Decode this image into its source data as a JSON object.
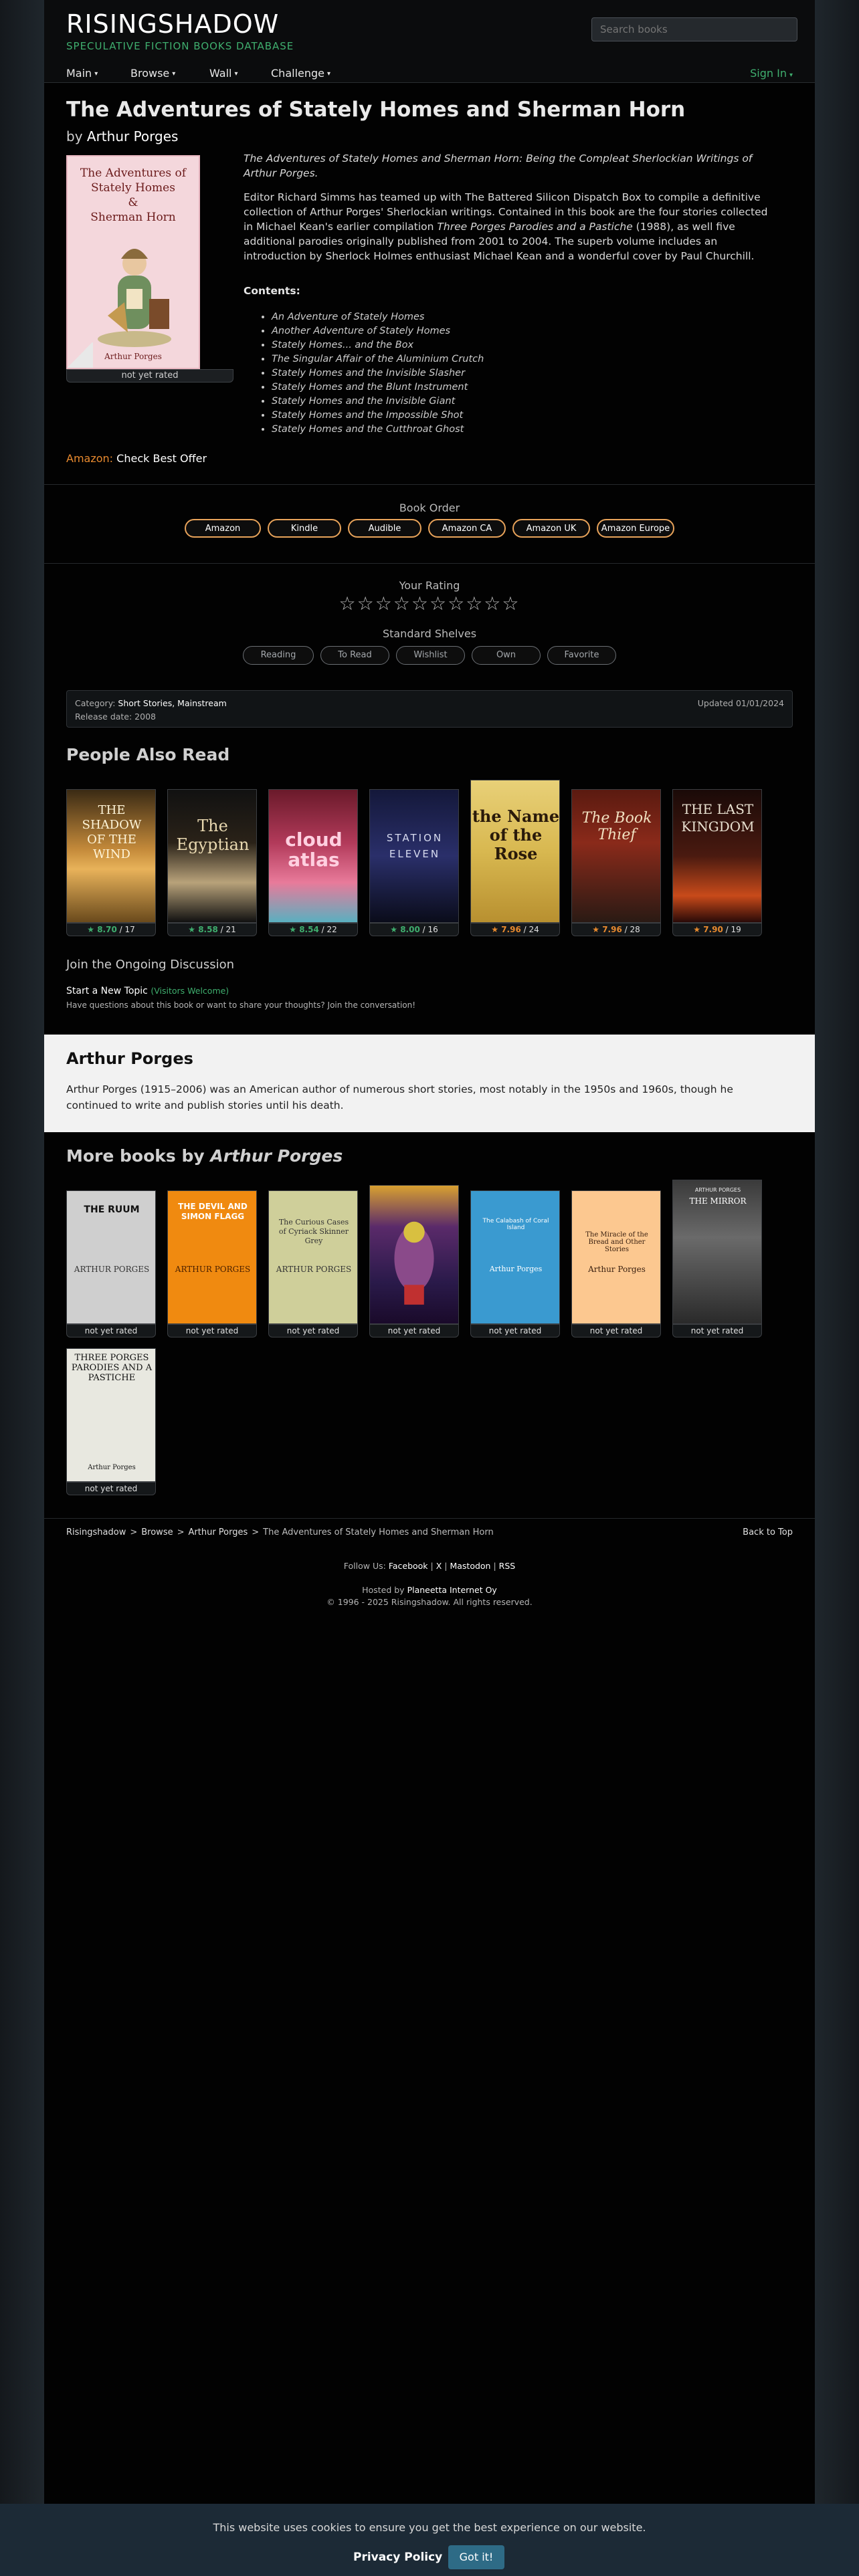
{
  "header": {
    "brand": "RISINGSHADOW",
    "tagline": "SPECULATIVE FICTION BOOKS DATABASE",
    "search_placeholder": "Search books",
    "nav": [
      "Main",
      "Browse",
      "Wall",
      "Challenge"
    ],
    "signin": "Sign In"
  },
  "book": {
    "title": "The Adventures of Stately Homes and Sherman Horn",
    "by": "by",
    "author": "Arthur Porges",
    "cover_title": [
      "The Adventures of",
      "Stately Homes",
      "&",
      "Sherman Horn"
    ],
    "cover_author": "Arthur Porges",
    "rating_label": "not yet rated",
    "desc_italic": "The Adventures of Stately Homes and Sherman Horn: Being the Compleat Sherlockian Writings of Arthur Porges.",
    "desc_p2a": "Editor Richard Simms has teamed up with The Battered Silicon Dispatch Box to compile a definitive collection of Arthur Porges' Sherlockian writings. Contained in this book are the four stories collected in Michael Kean's earlier compilation ",
    "desc_p2_title": "Three Porges Parodies and a Pastiche",
    "desc_p2b": " (1988), as well five additional parodies originally published from 2001 to 2004. The superb volume includes an introduction by Sherlock Holmes enthusiast Michael Kean and a wonderful cover by Paul Churchill.",
    "contents_label": "Contents:",
    "contents": [
      "An Adventure of Stately Homes",
      "Another Adventure of Stately Homes",
      "Stately Homes... and the Box",
      "The Singular Affair of the Aluminium Crutch",
      "Stately Homes and the Invisible Slasher",
      "Stately Homes and the Blunt Instrument",
      "Stately Homes and the Invisible Giant",
      "Stately Homes and the Impossible Shot",
      "Stately Homes and the Cutthroat Ghost"
    ],
    "amazon_label": "Amazon:",
    "amazon_offer": "Check Best Offer"
  },
  "order": {
    "heading": "Book Order",
    "buttons": [
      "Amazon",
      "Kindle",
      "Audible",
      "Amazon CA",
      "Amazon UK",
      "Amazon Europe"
    ]
  },
  "rating": {
    "heading": "Your Rating",
    "stars": "☆☆☆☆☆☆☆☆☆☆",
    "shelves_heading": "Standard Shelves",
    "shelves": [
      "Reading",
      "To Read",
      "Wishlist",
      "Own",
      "Favorite"
    ]
  },
  "info": {
    "category_label": "Category:",
    "category_value": "Short Stories, Mainstream",
    "release": "Release date: 2008",
    "updated": "Updated 01/01/2024"
  },
  "people_also_read": {
    "heading": "People Also Read",
    "books": [
      {
        "score": "8.70",
        "count": "17",
        "color": "#3fae6e",
        "cover_text": "THE SHADOW OF THE WIND"
      },
      {
        "score": "8.58",
        "count": "21",
        "color": "#3fae6e",
        "cover_text": "The Egyptian"
      },
      {
        "score": "8.54",
        "count": "22",
        "color": "#3fae6e",
        "cover_text": "cloud atlas"
      },
      {
        "score": "8.00",
        "count": "16",
        "color": "#3fae6e",
        "cover_text": "STATION ELEVEN"
      },
      {
        "score": "7.96",
        "count": "24",
        "color": "#e88a2f",
        "cover_text": "the Name of the Rose"
      },
      {
        "score": "7.96",
        "count": "28",
        "color": "#e88a2f",
        "cover_text": "The Book Thief"
      },
      {
        "score": "7.90",
        "count": "19",
        "color": "#e88a2f",
        "cover_text": "THE LAST KINGDOM"
      }
    ]
  },
  "discussion": {
    "heading": "Join the Ongoing Discussion",
    "new_topic": "Start a New Topic",
    "visitors": "(Visitors Welcome)",
    "prompt": "Have questions about this book or want to share your thoughts? Join the conversation!"
  },
  "author_box": {
    "name": "Arthur Porges",
    "bio": "Arthur Porges (1915–2006) was an American author of numerous short stories, most notably in the 1950s and 1960s, though he continued to write and publish stories until his death."
  },
  "more_books": {
    "heading_prefix": "More books by",
    "author": "Arthur Porges",
    "rating_label": "not yet rated",
    "books": [
      {
        "cover_text": "THE RUUM",
        "sub": "ARTHUR PORGES"
      },
      {
        "cover_text": "THE DEVIL AND SIMON FLAGG",
        "sub": "ARTHUR PORGES"
      },
      {
        "cover_text": "The Curious Cases of Cyriack Skinner Grey",
        "sub": "ARTHUR PORGES"
      },
      {
        "cover_text": "",
        "sub": ""
      },
      {
        "cover_text": "The Calabash of Coral Island",
        "sub": "Arthur Porges"
      },
      {
        "cover_text": "The Miracle of the Bread and Other Stories",
        "sub": "Arthur Porges"
      },
      {
        "cover_text": "THE MIRROR",
        "sub": "ARTHUR PORGES"
      },
      {
        "cover_text": "THREE PORGES PARODIES AND A PASTICHE",
        "sub": "Arthur Porges"
      }
    ]
  },
  "breadcrumb": [
    "Risingshadow",
    "Browse",
    "Arthur Porges",
    "The Adventures of Stately Homes and Sherman Horn"
  ],
  "back_to_top": "Back to Top",
  "footer": {
    "follow": "Follow Us:",
    "links": [
      "Facebook",
      "X",
      "Mastodon",
      "RSS"
    ],
    "hosted": "Hosted by",
    "host": "Planeetta Internet Oy",
    "copyright": "© 1996 - 2025 Risingshadow. All rights reserved."
  },
  "cookie": {
    "message": "This website uses cookies to ensure you get the best experience on our website.",
    "privacy": "Privacy Policy",
    "ok": "Got it!"
  }
}
